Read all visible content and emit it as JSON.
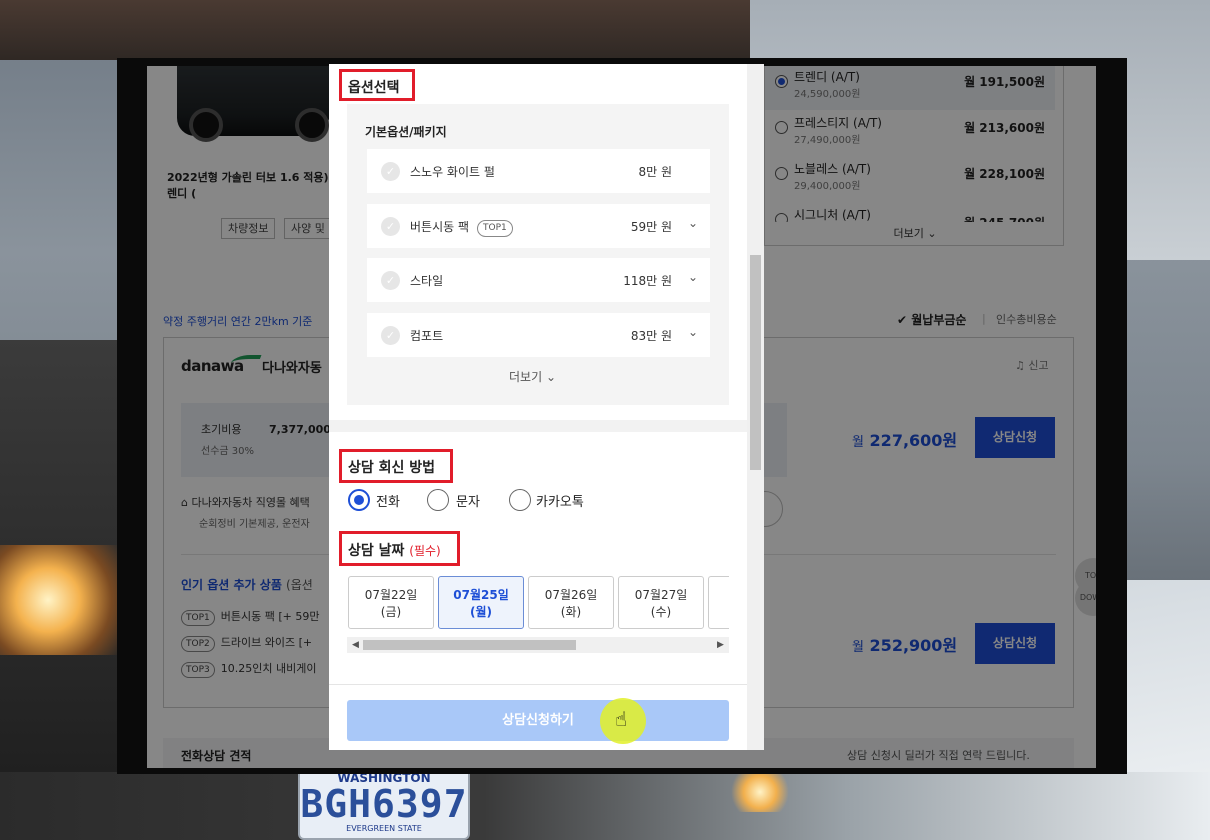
{
  "backdrop": {
    "plate_state": "WASHINGTON",
    "plate_number": "BGH6397",
    "plate_footer": "EVERGREEN STATE"
  },
  "page": {
    "car_title": "2022년형 가솔린 터보 1.6 적용) 트렌디 (",
    "tags": [
      "차량정보",
      "사양 및"
    ],
    "trims": [
      {
        "name": "트렌디 (A/T)",
        "price": "24,590,000원",
        "monthly": "월 191,500원",
        "selected": true
      },
      {
        "name": "프레스티지 (A/T)",
        "price": "27,490,000원",
        "monthly": "월 213,600원",
        "selected": false
      },
      {
        "name": "노블레스 (A/T)",
        "price": "29,400,000원",
        "monthly": "월 228,100원",
        "selected": false
      },
      {
        "name": "시그니처 (A/T)",
        "price": "",
        "monthly": "월 245,700원",
        "selected": false
      }
    ],
    "trims_more": "더보기",
    "notice": "약정 주행거리 연간 2만km 기준",
    "sort": {
      "active": "월납부금순",
      "inactive": "인수총비용순",
      "sep": "|"
    },
    "dealer": {
      "brand": "danawa",
      "name": "다나와자동",
      "report": "신고",
      "initial_cost_label": "초기비용",
      "initial_cost_value": "7,377,000원",
      "deposit": "선수금 30%",
      "price1_prefix": "월",
      "price1": "227,600원",
      "price2_prefix": "월",
      "price2": "252,900원",
      "apply_label": "상담신청",
      "benefit": "다나와자동차 직영몰 혜택",
      "benefit_sub": "순회정비 기본제공, 운전자",
      "popular_title": "인기 옵션 추가 상품",
      "popular_suffix": "(옵션",
      "popular": [
        {
          "badge": "TOP1",
          "text": "버튼시동 팩 [+ 59만"
        },
        {
          "badge": "TOP2",
          "text": "드라이브 와이즈 [+"
        },
        {
          "badge": "TOP3",
          "text": "10.25인치 내비게이"
        }
      ]
    },
    "footer_title": "전화상담 견적",
    "footer_note": "상담 신청시 딜러가 직접 연락 드립니다.",
    "side_buttons": [
      "TOP",
      "DOWN"
    ]
  },
  "modal": {
    "options_title": "옵션선택",
    "options_group": "기본옵션/패키지",
    "options": [
      {
        "name": "스노우 화이트 펄",
        "badge": "",
        "price": "8만 원",
        "expandable": false
      },
      {
        "name": "버튼시동 팩",
        "badge": "TOP1",
        "price": "59만 원",
        "expandable": true
      },
      {
        "name": "스타일",
        "badge": "",
        "price": "118만 원",
        "expandable": true
      },
      {
        "name": "컴포트",
        "badge": "",
        "price": "83만 원",
        "expandable": true
      }
    ],
    "options_more": "더보기",
    "reply_title": "상담 회신 방법",
    "reply_methods": [
      {
        "label": "전화",
        "selected": true
      },
      {
        "label": "문자",
        "selected": false
      },
      {
        "label": "카카오톡",
        "selected": false
      }
    ],
    "date_title": "상담 날짜",
    "date_required": "(필수)",
    "dates": [
      {
        "date": "07월22일",
        "day": "(금)",
        "selected": false
      },
      {
        "date": "07월25일",
        "day": "(월)",
        "selected": true
      },
      {
        "date": "07월26일",
        "day": "(화)",
        "selected": false
      },
      {
        "date": "07월27일",
        "day": "(수)",
        "selected": false
      }
    ],
    "submit_label": "상담신청하기"
  }
}
